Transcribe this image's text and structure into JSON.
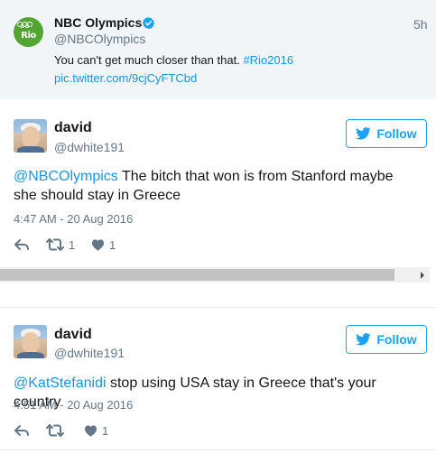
{
  "quoted_tweet": {
    "avatar_text": "Rio",
    "name": "NBC Olympics",
    "handle": "@NBCOlympics",
    "time": "5h",
    "text": "You can't get much closer than that.",
    "hashtag": "#Rio2016",
    "link": "pic.twitter.com/9cjCyFTCbd"
  },
  "tweets": [
    {
      "name": "david",
      "handle": "@dwhite191",
      "follow_label": "Follow",
      "mention": "@NBCOlympics",
      "text": " The bitch that won is from Stanford maybe she should stay in Greece",
      "date": "4:47 AM - 20 Aug 2016",
      "retweets": "1",
      "likes": "1"
    },
    {
      "name": "david",
      "handle": "@dwhite191",
      "follow_label": "Follow",
      "mention": "@KatStefanidi",
      "text": " stop using USA stay in Greece that's your country",
      "date": "4:51 AM - 20 Aug 2016",
      "retweets": "",
      "likes": "1"
    }
  ],
  "colors": {
    "link_blue": "#1b95e0",
    "follow_blue": "#1da1f2",
    "muted_gray": "#657786",
    "quoted_bg": "#f1f5f8"
  },
  "icons": [
    "rio-logo",
    "verified-icon",
    "twitter-bird-icon",
    "reply-icon",
    "retweet-icon",
    "heart-icon",
    "scroll-right-arrow-icon"
  ]
}
